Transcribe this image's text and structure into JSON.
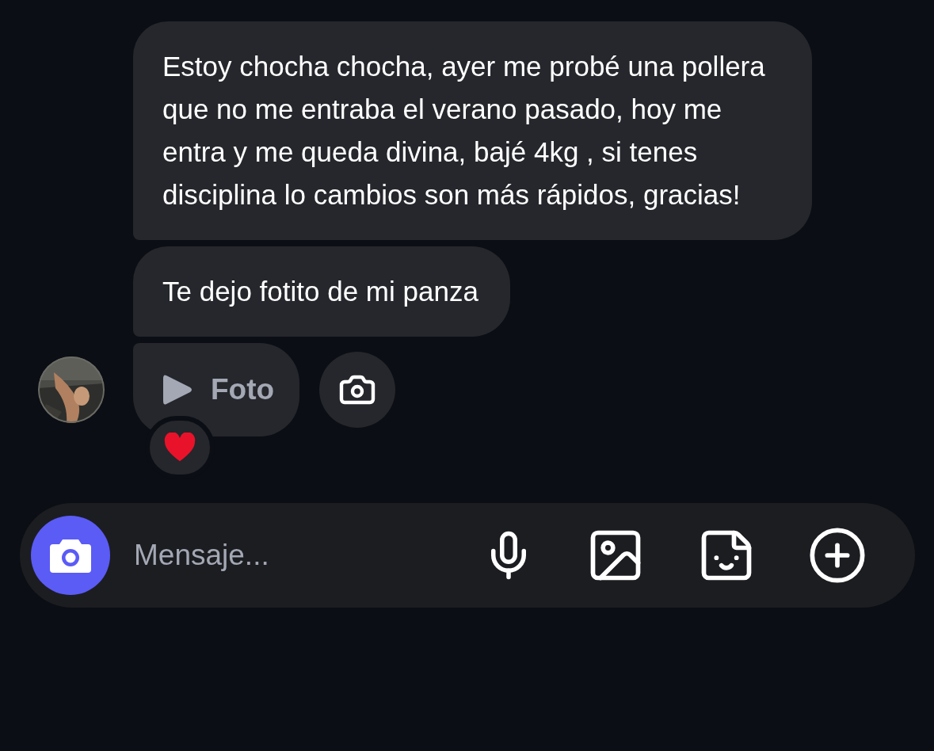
{
  "messages": [
    {
      "kind": "text",
      "text": "Estoy chocha chocha, ayer me probé una pollera que no me entraba el verano pasado, hoy me entra y me queda divina, bajé 4kg , si tenes disciplina lo cambios son más rápidos, gracias!"
    },
    {
      "kind": "text",
      "text": "Te dejo fotito de mi panza"
    },
    {
      "kind": "media",
      "label": "Foto",
      "reacted": true
    }
  ],
  "composer": {
    "placeholder": "Mensaje..."
  }
}
